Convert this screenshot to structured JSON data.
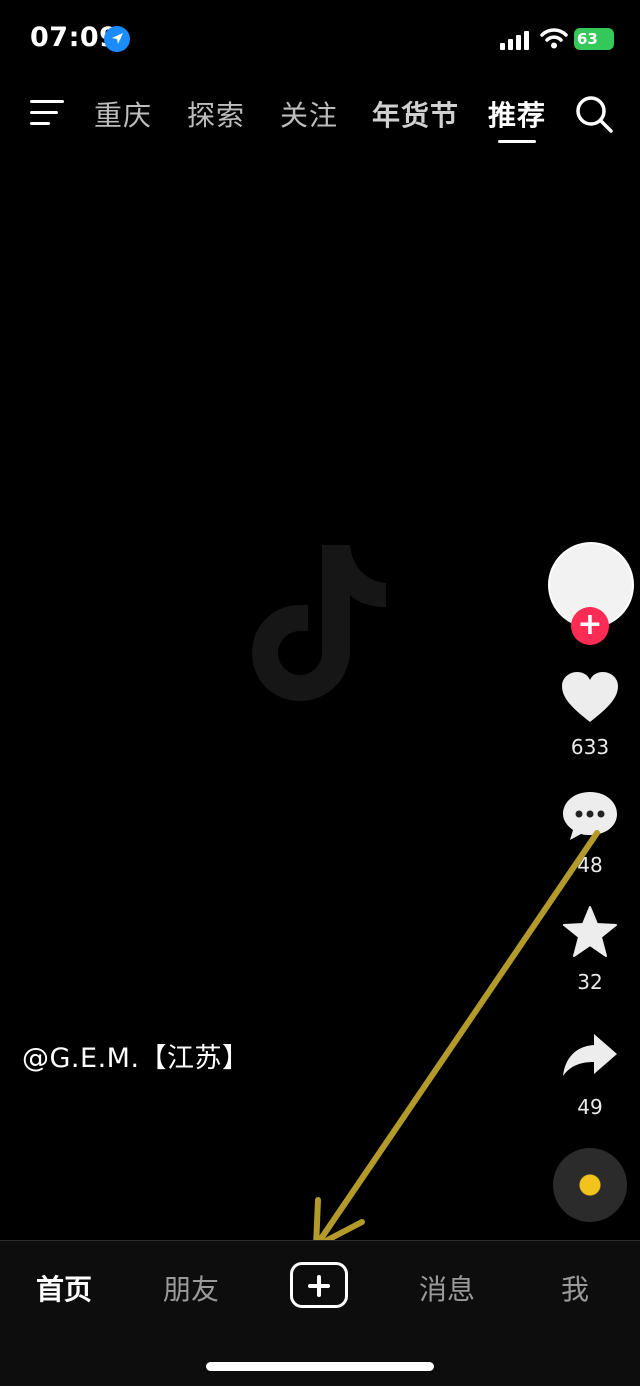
{
  "status_bar": {
    "time": "07:09",
    "battery": "63"
  },
  "top_nav": {
    "tabs": [
      {
        "label": "重庆"
      },
      {
        "label": "探索"
      },
      {
        "label": "关注"
      },
      {
        "label": "年货节"
      },
      {
        "label": "推荐"
      }
    ],
    "active_tab": "推荐"
  },
  "video": {
    "author": "@G.E.M.【江苏】",
    "follow_symbol": "+"
  },
  "actions": {
    "likes": "633",
    "comments": "48",
    "favorites": "32",
    "shares": "49"
  },
  "bottom_nav": {
    "items": [
      {
        "label": "首页"
      },
      {
        "label": "朋友"
      },
      {
        "label": "消息"
      },
      {
        "label": "我"
      }
    ],
    "active": "首页"
  },
  "colors": {
    "background": "#000000",
    "accent_red": "#fe2c55",
    "battery_green": "#34c759",
    "annotation_arrow": "#b39a2a",
    "location_blue": "#1a8cff"
  },
  "icons": [
    "location-arrow-icon",
    "signal-icon",
    "wifi-icon",
    "battery-icon",
    "menu-icon",
    "search-icon",
    "tiktok-logo-icon",
    "heart-icon",
    "comment-icon",
    "star-icon",
    "share-icon",
    "music-disc-icon",
    "plus-icon"
  ]
}
